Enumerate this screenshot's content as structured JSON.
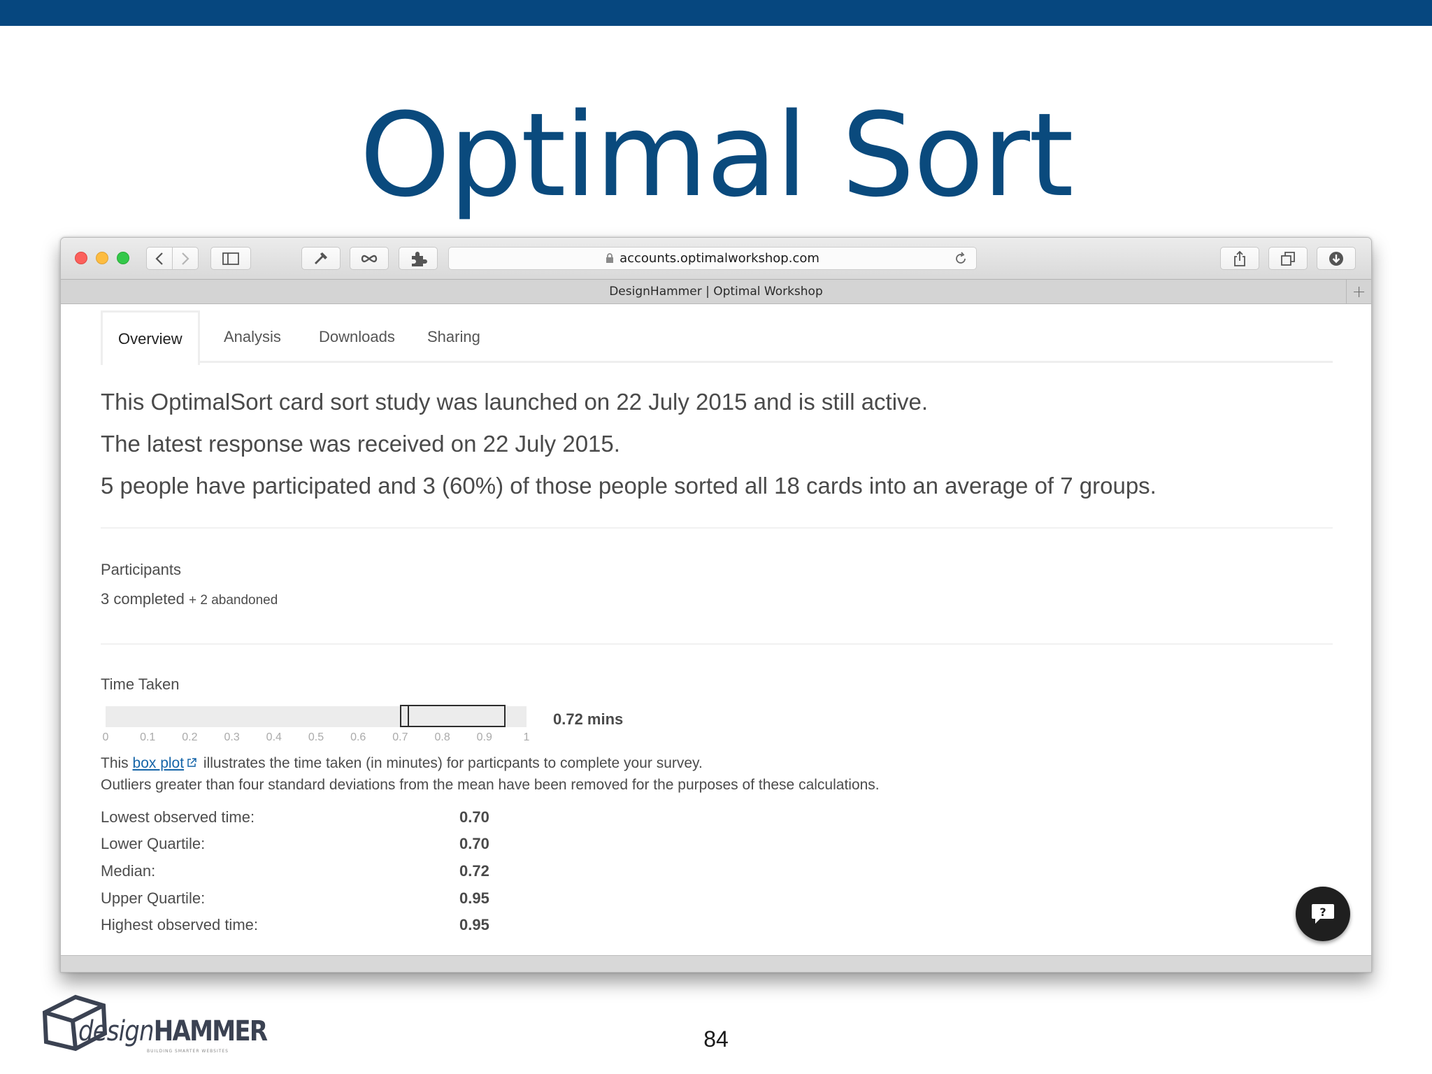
{
  "slide": {
    "title": "Optimal Sort",
    "page_number": "84",
    "logo": {
      "text_upper": "HAMMER",
      "text_lower": "design",
      "tagline": "BUILDING SMARTER WEBSITES"
    }
  },
  "browser": {
    "url": "accounts.optimalworkshop.com",
    "tab_title": "DesignHammer | Optimal Workshop"
  },
  "nav_tabs": [
    {
      "label": "Overview",
      "active": true
    },
    {
      "label": "Analysis",
      "active": false
    },
    {
      "label": "Downloads",
      "active": false
    },
    {
      "label": "Sharing",
      "active": false
    }
  ],
  "summary": [
    "This OptimalSort card sort study was launched on 22 July 2015 and is still active.",
    "The latest response was received on 22 July 2015.",
    "5 people have participated and 3 (60%) of those people sorted all 18 cards into an average of 7 groups."
  ],
  "participants": {
    "heading": "Participants",
    "completed": "3 completed",
    "abandoned": "+ 2 abandoned"
  },
  "time_taken": {
    "heading": "Time Taken",
    "value_label": "0.72 mins",
    "axis_ticks": [
      "0",
      "0.1",
      "0.2",
      "0.3",
      "0.4",
      "0.5",
      "0.6",
      "0.7",
      "0.8",
      "0.9",
      "1"
    ],
    "box": {
      "lower": 0.7,
      "median": 0.72,
      "upper": 0.95
    },
    "desc_prefix": "This ",
    "desc_link": "box plot",
    "desc_suffix": " illustrates the time taken (in minutes) for particpants to complete your survey.",
    "desc_line2": "Outliers greater than four standard deviations from the mean have been removed for the purposes of these calculations."
  },
  "stats": [
    {
      "label": "Lowest observed time:",
      "value": "0.70"
    },
    {
      "label": "Lower Quartile:",
      "value": "0.70"
    },
    {
      "label": "Median:",
      "value": "0.72"
    },
    {
      "label": "Upper Quartile:",
      "value": "0.95"
    },
    {
      "label": "Highest observed time:",
      "value": "0.95"
    }
  ],
  "colors": {
    "brand_blue": "#0a4a7d",
    "link": "#1565a8"
  }
}
